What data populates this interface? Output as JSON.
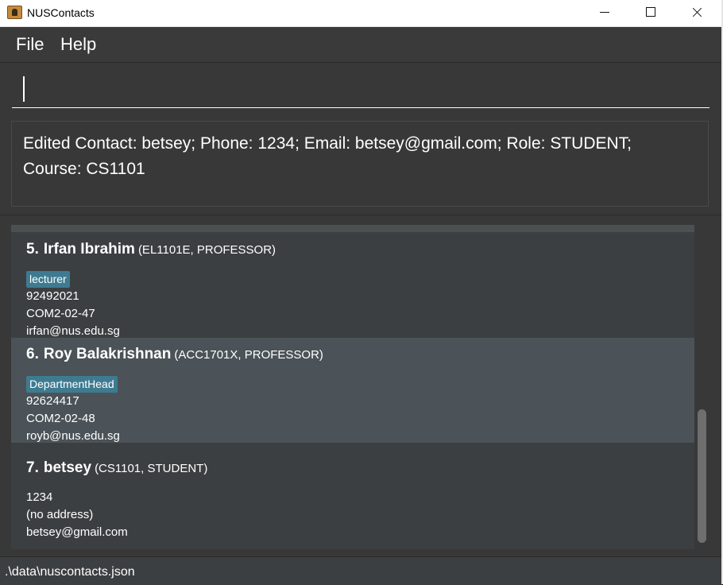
{
  "window": {
    "title": "NUSContacts"
  },
  "menu": {
    "file": "File",
    "help": "Help"
  },
  "command": {
    "value": ""
  },
  "result": {
    "message": "Edited Contact: betsey; Phone: 1234; Email: betsey@gmail.com; Role: STUDENT; Course: CS1101"
  },
  "persons": [
    {
      "index": "5.",
      "name": "Irfan Ibrahim",
      "meta": "(EL1101E,  PROFESSOR)",
      "tag": "lecturer",
      "phone": "92492021",
      "address": "COM2-02-47",
      "email": "irfan@nus.edu.sg"
    },
    {
      "index": "6.",
      "name": "Roy Balakrishnan",
      "meta": "(ACC1701X,  PROFESSOR)",
      "tag": "DepartmentHead",
      "phone": "92624417",
      "address": "COM2-02-48",
      "email": "royb@nus.edu.sg"
    },
    {
      "index": "7.",
      "name": "betsey",
      "meta": "(CS1101,  STUDENT)",
      "phone": "1234",
      "address": "(no address)",
      "email": "betsey@gmail.com"
    }
  ],
  "status": {
    "file_path": ".\\data\\nuscontacts.json"
  },
  "colors": {
    "background": "#383838",
    "card": "#3c3f41",
    "card_selected": "#4b5358",
    "tag": "#3e7b91"
  }
}
